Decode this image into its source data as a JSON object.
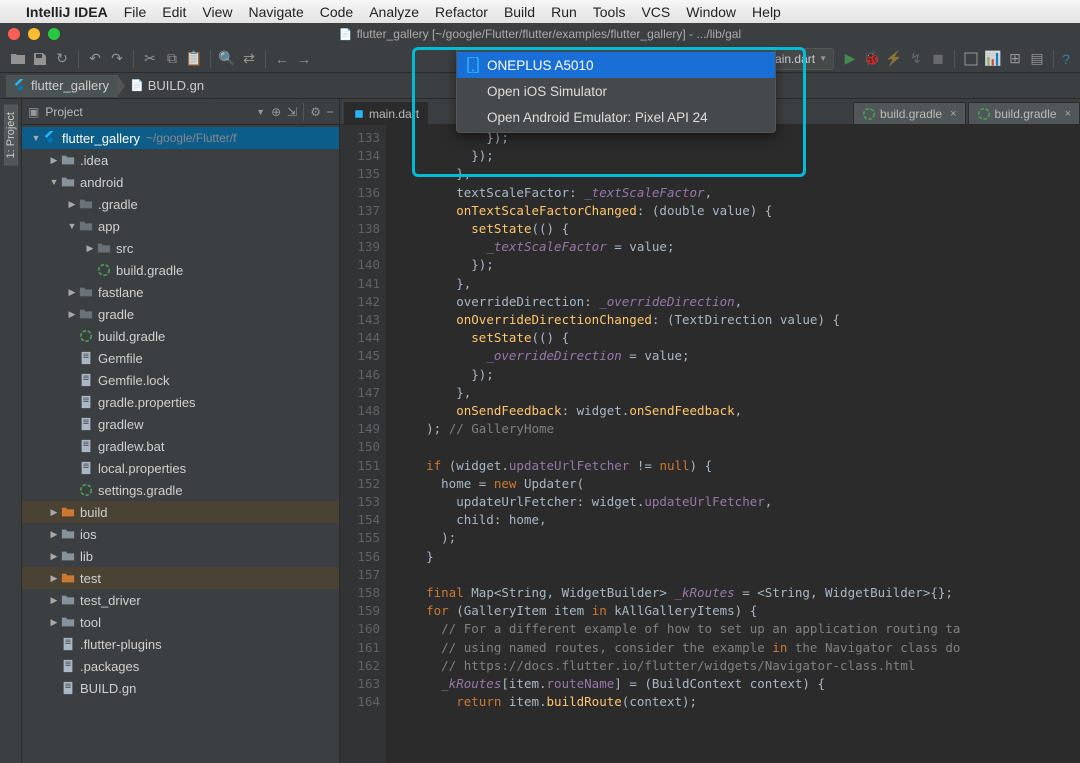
{
  "mac_menu": {
    "app": "IntelliJ IDEA",
    "items": [
      "File",
      "Edit",
      "View",
      "Navigate",
      "Code",
      "Analyze",
      "Refactor",
      "Build",
      "Run",
      "Tools",
      "VCS",
      "Window",
      "Help"
    ]
  },
  "window_title": "flutter_gallery [~/google/Flutter/flutter/examples/flutter_gallery] - .../lib/gal",
  "device_selector": {
    "label": "ONEPLUS A5010"
  },
  "run_config": {
    "label": "main.dart"
  },
  "device_popup": {
    "items": [
      {
        "label": "ONEPLUS A5010",
        "selected": true,
        "has_icon": true
      },
      {
        "label": "Open iOS Simulator",
        "selected": false,
        "has_icon": false
      },
      {
        "label": "Open Android Emulator: Pixel API 24",
        "selected": false,
        "has_icon": false
      }
    ]
  },
  "breadcrumb": {
    "project": "flutter_gallery",
    "file": "BUILD.gn"
  },
  "project_panel": {
    "title": "Project",
    "tree": [
      {
        "d": 0,
        "exp": "down",
        "kind": "flutter",
        "label": "flutter_gallery",
        "suffix": "~/google/Flutter/f",
        "hl": "sel"
      },
      {
        "d": 1,
        "exp": "right",
        "kind": "folder",
        "label": ".idea"
      },
      {
        "d": 1,
        "exp": "down",
        "kind": "folder",
        "label": "android"
      },
      {
        "d": 2,
        "exp": "right",
        "kind": "folder-dark",
        "label": ".gradle"
      },
      {
        "d": 2,
        "exp": "down",
        "kind": "folder-dark",
        "label": "app"
      },
      {
        "d": 3,
        "exp": "right",
        "kind": "folder-dark",
        "label": "src"
      },
      {
        "d": 3,
        "exp": "none",
        "kind": "gradle",
        "label": "build.gradle"
      },
      {
        "d": 2,
        "exp": "right",
        "kind": "folder-dark",
        "label": "fastlane"
      },
      {
        "d": 2,
        "exp": "right",
        "kind": "folder-dark",
        "label": "gradle"
      },
      {
        "d": 2,
        "exp": "none",
        "kind": "gradle",
        "label": "build.gradle"
      },
      {
        "d": 2,
        "exp": "none",
        "kind": "file",
        "label": "Gemfile"
      },
      {
        "d": 2,
        "exp": "none",
        "kind": "file",
        "label": "Gemfile.lock"
      },
      {
        "d": 2,
        "exp": "none",
        "kind": "file",
        "label": "gradle.properties"
      },
      {
        "d": 2,
        "exp": "none",
        "kind": "file",
        "label": "gradlew"
      },
      {
        "d": 2,
        "exp": "none",
        "kind": "file",
        "label": "gradlew.bat"
      },
      {
        "d": 2,
        "exp": "none",
        "kind": "file",
        "label": "local.properties"
      },
      {
        "d": 2,
        "exp": "none",
        "kind": "gradle",
        "label": "settings.gradle"
      },
      {
        "d": 1,
        "exp": "right",
        "kind": "folder-hl",
        "label": "build",
        "hl": "hl"
      },
      {
        "d": 1,
        "exp": "right",
        "kind": "folder",
        "label": "ios"
      },
      {
        "d": 1,
        "exp": "right",
        "kind": "folder",
        "label": "lib"
      },
      {
        "d": 1,
        "exp": "right",
        "kind": "folder-hl",
        "label": "test",
        "hl": "hl"
      },
      {
        "d": 1,
        "exp": "right",
        "kind": "folder",
        "label": "test_driver"
      },
      {
        "d": 1,
        "exp": "right",
        "kind": "folder",
        "label": "tool"
      },
      {
        "d": 1,
        "exp": "none",
        "kind": "file",
        "label": ".flutter-plugins"
      },
      {
        "d": 1,
        "exp": "none",
        "kind": "file",
        "label": ".packages"
      },
      {
        "d": 1,
        "exp": "none",
        "kind": "file",
        "label": "BUILD.gn"
      }
    ]
  },
  "left_gutter": {
    "label": "Project",
    "index": "1:"
  },
  "editor_tabs": [
    {
      "label": "main.dart",
      "kind": "dart",
      "active": true
    },
    {
      "label": "build.gradle",
      "kind": "gradle",
      "active": false,
      "closable": true
    },
    {
      "label": "build.gradle",
      "kind": "gradle",
      "active": false,
      "closable": true
    }
  ],
  "editor": {
    "first_line": 133,
    "lines": [
      "            });",
      "          });",
      "        },",
      "        textScaleFactor: _textScaleFactor,",
      "        onTextScaleFactorChanged: (double value) {",
      "          setState(() {",
      "            _textScaleFactor = value;",
      "          });",
      "        },",
      "        overrideDirection: _overrideDirection,",
      "        onOverrideDirectionChanged: (TextDirection value) {",
      "          setState(() {",
      "            _overrideDirection = value;",
      "          });",
      "        },",
      "        onSendFeedback: widget.onSendFeedback,",
      "    ); // GalleryHome",
      "",
      "    if (widget.updateUrlFetcher != null) {",
      "      home = new Updater(",
      "        updateUrlFetcher: widget.updateUrlFetcher,",
      "        child: home,",
      "      );",
      "    }",
      "",
      "    final Map<String, WidgetBuilder> _kRoutes = <String, WidgetBuilder>{};",
      "    for (GalleryItem item in kAllGalleryItems) {",
      "      // For a different example of how to set up an application routing ta",
      "      // using named routes, consider the example in the Navigator class do",
      "      // https://docs.flutter.io/flutter/widgets/Navigator-class.html",
      "      _kRoutes[item.routeName] = (BuildContext context) {",
      "        return item.buildRoute(context);"
    ]
  }
}
